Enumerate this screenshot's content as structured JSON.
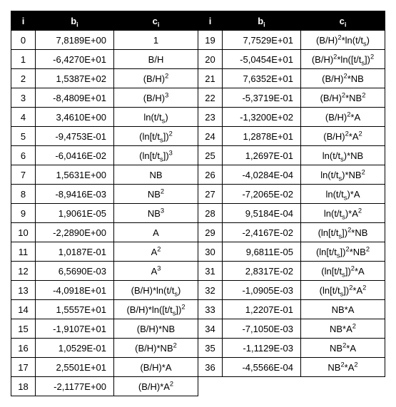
{
  "chart_data": {
    "type": "table",
    "title": "",
    "columns": [
      "i",
      "b_i",
      "c_i"
    ],
    "rows_left": [
      {
        "i": 0,
        "b": "7,8189E+00",
        "c": "1"
      },
      {
        "i": 1,
        "b": "-6,4270E+01",
        "c": "B/H"
      },
      {
        "i": 2,
        "b": "1,5387E+02",
        "c": "(B/H)^2"
      },
      {
        "i": 3,
        "b": "-8,4809E+01",
        "c": "(B/H)^3"
      },
      {
        "i": 4,
        "b": "3,4610E+00",
        "c": "ln(t/t_s)"
      },
      {
        "i": 5,
        "b": "-9,4753E-01",
        "c": "(ln[t/t_s])^2"
      },
      {
        "i": 6,
        "b": "-6,0416E-02",
        "c": "(ln[t/t_s])^3"
      },
      {
        "i": 7,
        "b": "1,5631E+00",
        "c": "NB"
      },
      {
        "i": 8,
        "b": "-8,9416E-03",
        "c": "NB^2"
      },
      {
        "i": 9,
        "b": "1,9061E-05",
        "c": "NB^3"
      },
      {
        "i": 10,
        "b": "-2,2890E+00",
        "c": "A"
      },
      {
        "i": 11,
        "b": "1,0187E-01",
        "c": "A^2"
      },
      {
        "i": 12,
        "b": "6,5690E-03",
        "c": "A^3"
      },
      {
        "i": 13,
        "b": "-4,0918E+01",
        "c": "(B/H)*ln(t/t_s)"
      },
      {
        "i": 14,
        "b": "1,5557E+01",
        "c": "(B/H)*ln([t/t_s])^2"
      },
      {
        "i": 15,
        "b": "-1,9107E+01",
        "c": "(B/H)*NB"
      },
      {
        "i": 16,
        "b": "1,0529E-01",
        "c": "(B/H)*NB^2"
      },
      {
        "i": 17,
        "b": "2,5501E+01",
        "c": "(B/H)*A"
      },
      {
        "i": 18,
        "b": "-2,1177E+00",
        "c": "(B/H)*A^2"
      }
    ],
    "rows_right": [
      {
        "i": 19,
        "b": "7,7529E+01",
        "c": "(B/H)^2*ln(t/t_s)"
      },
      {
        "i": 20,
        "b": "-5,0454E+01",
        "c": "(B/H)^2*ln([t/t_s])^2"
      },
      {
        "i": 21,
        "b": "7,6352E+01",
        "c": "(B/H)^2*NB"
      },
      {
        "i": 22,
        "b": "-5,3719E-01",
        "c": "(B/H)^2*NB^2"
      },
      {
        "i": 23,
        "b": "-1,3200E+02",
        "c": "(B/H)^2*A"
      },
      {
        "i": 24,
        "b": "1,2878E+01",
        "c": "(B/H)^2*A^2"
      },
      {
        "i": 25,
        "b": "1,2697E-01",
        "c": "ln(t/t_s)*NB"
      },
      {
        "i": 26,
        "b": "-4,0284E-04",
        "c": "ln(t/t_s)*NB^2"
      },
      {
        "i": 27,
        "b": "-7,2065E-02",
        "c": "ln(t/t_s)*A"
      },
      {
        "i": 28,
        "b": "9,5184E-04",
        "c": "ln(t/t_s)*A^2"
      },
      {
        "i": 29,
        "b": "-2,4167E-02",
        "c": "(ln[t/t_s])^2*NB"
      },
      {
        "i": 30,
        "b": "9,6811E-05",
        "c": "(ln[t/t_s])^2*NB^2"
      },
      {
        "i": 31,
        "b": "2,8317E-02",
        "c": "(ln[t/t_s])^2*A"
      },
      {
        "i": 32,
        "b": "-1,0905E-03",
        "c": "(ln[t/t_s])^2*A^2"
      },
      {
        "i": 33,
        "b": "1,2207E-01",
        "c": "NB*A"
      },
      {
        "i": 34,
        "b": "-7,1050E-03",
        "c": "NB*A^2"
      },
      {
        "i": 35,
        "b": "-1,1129E-03",
        "c": "NB^2*A"
      },
      {
        "i": 36,
        "b": "-4,5566E-04",
        "c": "NB^2*A^2"
      }
    ]
  },
  "headers": {
    "i": "i",
    "b": "b_i",
    "c": "c_i"
  }
}
